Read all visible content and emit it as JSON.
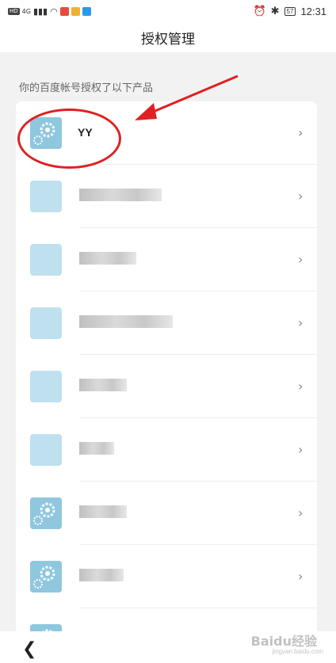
{
  "status_bar": {
    "hd": "HD",
    "net": "4G",
    "battery": "57",
    "time": "12:31"
  },
  "nav": {
    "title": "授权管理"
  },
  "subtitle": "你的百度帐号授权了以下产品",
  "products": [
    {
      "name": "YY",
      "icon": "gear-app-icon"
    },
    {
      "name": "",
      "icon": "blurred-app-icon"
    },
    {
      "name": "",
      "icon": "blurred-app-icon"
    },
    {
      "name": "",
      "icon": "blurred-app-icon"
    },
    {
      "name": "",
      "icon": "blurred-app-icon"
    },
    {
      "name": "",
      "icon": "blurred-app-icon"
    },
    {
      "name": "",
      "icon": "gear-app-icon"
    },
    {
      "name": "",
      "icon": "gear-app-icon"
    },
    {
      "name": "",
      "icon": "gear-app-icon"
    }
  ],
  "bottom": {
    "back_icon": "back-chevron-icon"
  },
  "watermark": {
    "text": "Baidu经验",
    "sub": "jingyan.baidu.com"
  },
  "colors": {
    "annotation": "#e02020",
    "icon_blue": "#8fc7df"
  }
}
